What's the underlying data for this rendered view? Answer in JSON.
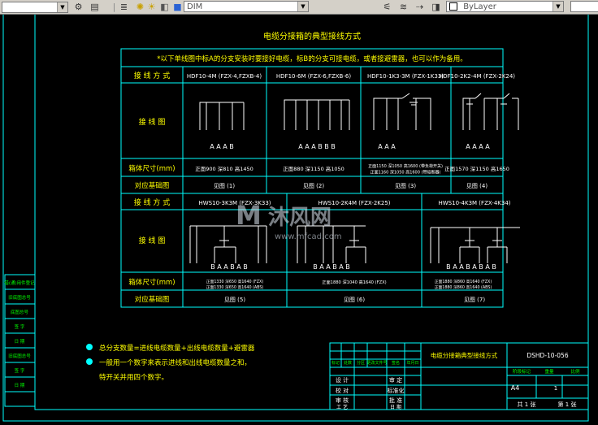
{
  "toolbar": {
    "dim_style": "DIM",
    "layer": "ByLayer",
    "icons": [
      "settings-icon",
      "properties-icon",
      "light-icon",
      "layer-icon",
      "color-square-icon",
      "text-style-icon",
      "layer-state-icon",
      "color-swatch-icon",
      "dropdown-icon"
    ]
  },
  "colors": {
    "lines": "#00ffff",
    "title": "#ffff00",
    "note": "#00ff00",
    "text": "#ffffff",
    "bullet": "#00ffff",
    "background": "#000000"
  },
  "sheet": {
    "title": "电缆分接箱的典型接线方式",
    "note": "*以下单线图中标A的分支安装时要接好电缆，标B的分支可接电缆，或者接避雷器，也可以作为备用。",
    "row_labels": {
      "wiring_mode": "接 线 方 式",
      "diagram": "接 线 图",
      "cabinet_size": "箱体尺寸(mm)",
      "foundation": "对应基础图"
    },
    "upper": [
      {
        "model": "HDF10-4M (FZX-4,FZXB-4)",
        "terminals": "A A A B",
        "size": "正面900  深810  高1450",
        "foundation": "见图 (1)"
      },
      {
        "model": "HDF10-6M (FZX-6,FZXB-6)",
        "terminals": "A A A B B B",
        "size": "正面880  深1150  高1050",
        "foundation": "见图 (2)"
      },
      {
        "model": "HDF10-1K3-3M (FZX-1K33)",
        "terminals": "A A A",
        "size": "正面1150 深1050 高1600 (带负荷开关)\n正面1160 深1050 高1600 (带熔断器)",
        "foundation": "见图 (3)"
      },
      {
        "model": "HDF10-2K2-4M (FZX-2K24)",
        "terminals": "A A A A",
        "size": "正面1570  深1150  高1650",
        "foundation": "见图 (4)"
      }
    ],
    "lower": [
      {
        "model": "HWS10-3K3M (FZX-3K33)",
        "terminals": "B A   A B   A B",
        "size": "正面1330 深650 高1640 (FZX)\n正面1330 深650 高1640 (ABS)",
        "foundation": "见图 (5)"
      },
      {
        "model": "HWS10-2K4M (FZX-2K25)",
        "terminals": "B A   A B   A B",
        "size": "正面1880 深1040 高1640 (FZX)",
        "foundation": "见图 (6)"
      },
      {
        "model": "HWS10-4K3M (FZX-4K34)",
        "terminals": "B A   A B   A B   A B",
        "size": "正面1880 深860 高1640 (FZX)\n正面1880 深860 高1640 (ABS)",
        "foundation": "见图 (7)"
      }
    ],
    "notes": [
      "总分支数量=进线电缆数量+出线电缆数量+避雷器",
      "一般用一个数字来表示进线和出线电缆数量之和，",
      "特开关并用四个数字。"
    ],
    "left_strip": [
      "借(通)用件登记",
      "旧底图总号",
      "底图总号",
      "签  字",
      "日  期",
      "旧底图总号",
      "签  字",
      "日  期"
    ],
    "title_block": {
      "drawing_no": "DSHD-10-056",
      "drawing_title": "电缆分接箱典型接线方式",
      "stage": "A4",
      "scale": "1",
      "sheet_total": "共  1  张",
      "sheet_no": "第  1  张",
      "roles": [
        "设 计",
        "校 对",
        "审 核",
        "工 艺"
      ],
      "roles2": [
        "审 定",
        "标准化",
        "批 准",
        "日 期"
      ],
      "headers": [
        "标记",
        "处数",
        "分区",
        "更改文件号",
        "签名",
        "年月日"
      ],
      "stage_labels": [
        "阶段标记",
        "重量",
        "比例"
      ]
    },
    "watermark": {
      "text": "沐风网",
      "url": "www.mfcad.com"
    }
  }
}
